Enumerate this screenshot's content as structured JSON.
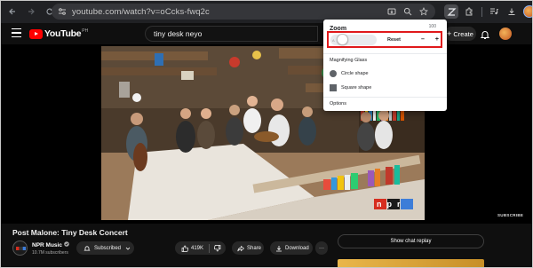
{
  "browser": {
    "url": "youtube.com/watch?v=oCcks-fwq2c"
  },
  "masthead": {
    "logo_text": "YouTube",
    "country_code": "PH",
    "search_query": "tiny desk neyo",
    "create_label": "Create"
  },
  "zoom_popup": {
    "title": "Zoom",
    "value": "100",
    "reset_label": "Reset",
    "minus_label": "–",
    "plus_label": "+",
    "slider_tick": "A",
    "magnifying_heading": "Magnifying Glass",
    "options": [
      {
        "label": "Circle shape",
        "icon": "circle-shape-icon"
      },
      {
        "label": "Square shape",
        "icon": "square-shape-icon"
      }
    ],
    "options_label": "Options",
    "highlight_color": "#e0191b"
  },
  "video": {
    "watermark_subscribe": "SUBSCRIBE",
    "watermark_logo": "npr"
  },
  "info": {
    "title": "Post Malone: Tiny Desk Concert",
    "channel_name": "NPR Music",
    "subscribers": "10.7M subscribers",
    "subscribed_label": "Subscribed",
    "likes": "419K",
    "share_label": "Share",
    "download_label": "Download",
    "more_label": "···",
    "show_chat_replay": "Show chat replay"
  },
  "colors": {
    "yt_red": "#ff0000",
    "bg": "#0f0f0f",
    "pill": "#272727"
  }
}
